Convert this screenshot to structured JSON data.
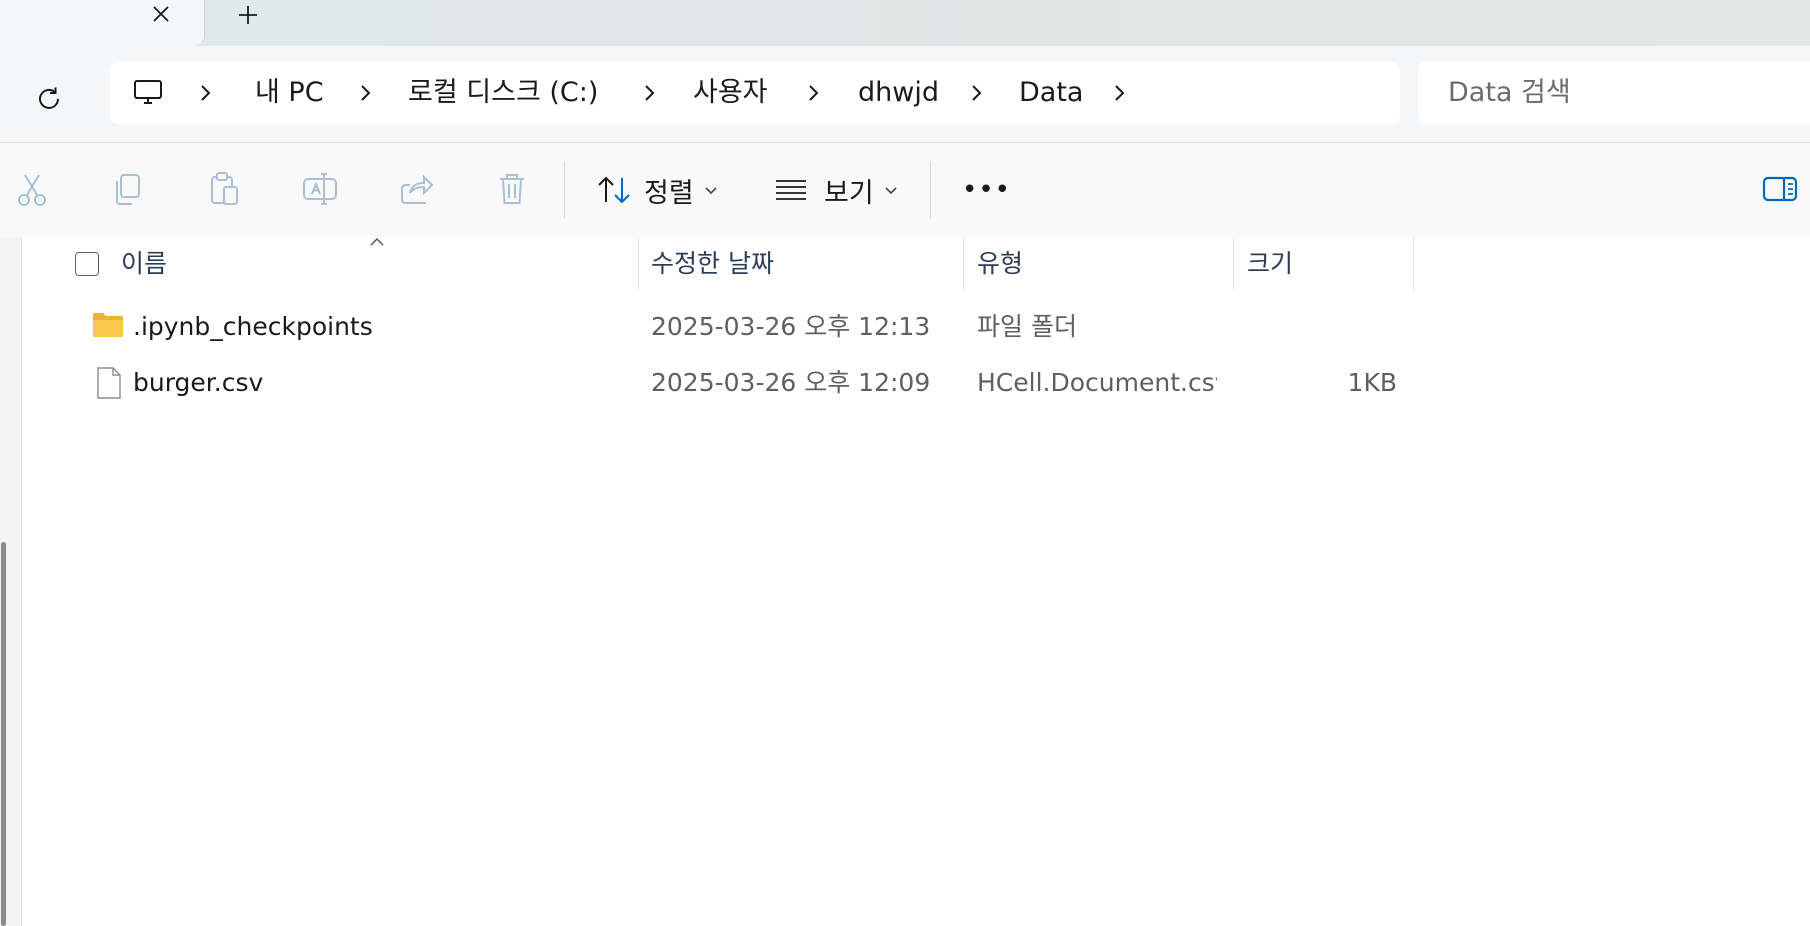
{
  "window": {
    "new_tab_label": "+"
  },
  "addressbar": {
    "crumbs": [
      "내 PC",
      "로컬 디스크 (C:)",
      "사용자",
      "dhwjd",
      "Data"
    ]
  },
  "search": {
    "placeholder": "Data 검색"
  },
  "commandbar": {
    "sort_label": "정렬",
    "view_label": "보기",
    "more_label": "•••"
  },
  "list": {
    "columns": {
      "name": "이름",
      "modified": "수정한 날짜",
      "type": "유형",
      "size": "크기"
    },
    "rows": [
      {
        "name": ".ipynb_checkpoints",
        "modified": "2025-03-26 오후 12:13",
        "type": "파일 폴더",
        "size": "",
        "icon": "folder-icon"
      },
      {
        "name": "burger.csv",
        "modified": "2025-03-26 오후 12:09",
        "type": "HCell.Document.csv....",
        "size": "1KB",
        "icon": "file-icon"
      }
    ]
  },
  "colors": {
    "accent": "#0067c0",
    "folder": "#f8c94a",
    "header_text": "#2c3e57"
  }
}
